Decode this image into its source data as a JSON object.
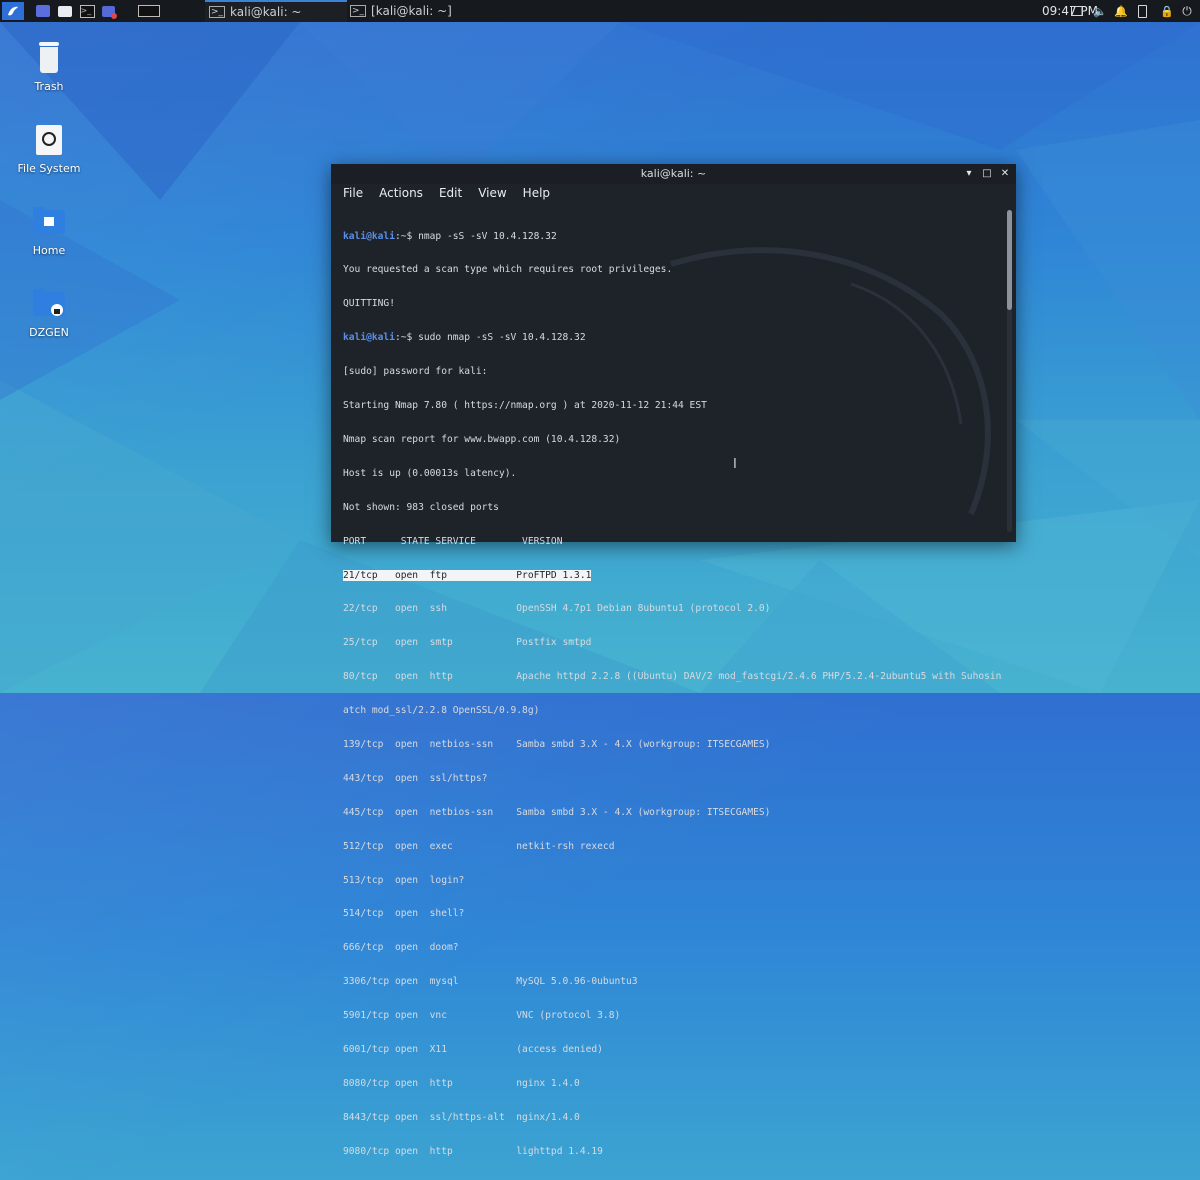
{
  "panel": {
    "tasks": [
      {
        "label": ""
      },
      {
        "label": "kali@kali: ~"
      },
      {
        "label": "[kali@kali: ~]"
      }
    ],
    "clock": "09:47 PM"
  },
  "desktop": {
    "icons": [
      {
        "label": "Trash"
      },
      {
        "label": "File System"
      },
      {
        "label": "Home"
      },
      {
        "label": "DZGEN"
      }
    ]
  },
  "terminal": {
    "title": "kali@kali: ~",
    "menu": [
      "File",
      "Actions",
      "Edit",
      "View",
      "Help"
    ],
    "prompt_user": "kali@kali",
    "prompt_suffix": ":~$ ",
    "cmd1": "nmap -sS -sV 10.4.128.32",
    "out1": "You requested a scan type which requires root privileges.",
    "out2": "QUITTING!",
    "cmd2": "sudo nmap -sS -sV 10.4.128.32",
    "lines": [
      "[sudo] password for kali:",
      "Starting Nmap 7.80 ( https://nmap.org ) at 2020-11-12 21:44 EST",
      "Nmap scan report for www.bwapp.com (10.4.128.32)",
      "Host is up (0.00013s latency).",
      "Not shown: 983 closed ports",
      "PORT      STATE SERVICE        VERSION"
    ],
    "highlight_line": "21/tcp   open  ftp            ProFTPD 1.3.1",
    "rows": [
      "22/tcp   open  ssh            OpenSSH 4.7p1 Debian 8ubuntu1 (protocol 2.0)",
      "25/tcp   open  smtp           Postfix smtpd",
      "80/tcp   open  http           Apache httpd 2.2.8 ((Ubuntu) DAV/2 mod_fastcgi/2.4.6 PHP/5.2.4-2ubuntu5 with Suhosin-P",
      "atch mod_ssl/2.2.8 OpenSSL/0.9.8g)",
      "139/tcp  open  netbios-ssn    Samba smbd 3.X - 4.X (workgroup: ITSECGAMES)",
      "443/tcp  open  ssl/https?",
      "445/tcp  open  netbios-ssn    Samba smbd 3.X - 4.X (workgroup: ITSECGAMES)",
      "512/tcp  open  exec           netkit-rsh rexecd",
      "513/tcp  open  login?",
      "514/tcp  open  shell?",
      "666/tcp  open  doom?",
      "3306/tcp open  mysql          MySQL 5.0.96-0ubuntu3",
      "5901/tcp open  vnc            VNC (protocol 3.8)",
      "6001/tcp open  X11            (access denied)",
      "8080/tcp open  http           nginx 1.4.0",
      "8443/tcp open  ssl/https-alt  nginx/1.4.0",
      "9080/tcp open  http           lighttpd 1.4.19"
    ]
  }
}
